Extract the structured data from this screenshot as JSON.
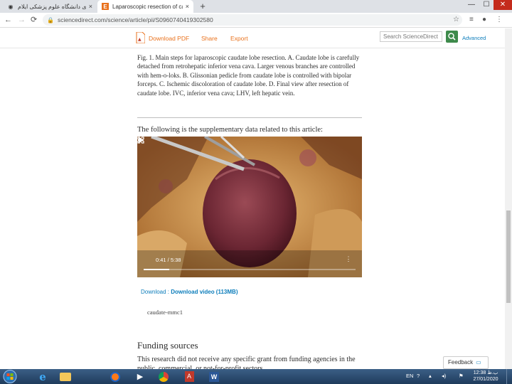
{
  "browser": {
    "tabs": [
      {
        "title": "کتابخانه مرکزی دانشگاه علوم پزشکی ایلام",
        "active": false
      },
      {
        "title": "Laparoscopic resection of caudate",
        "active": true
      }
    ],
    "new_tab": "+",
    "window_controls": {
      "minimize": "—",
      "maximize": "☐",
      "close": "✕"
    },
    "url": "sciencedirect.com/science/article/pii/S0960740419302580"
  },
  "header": {
    "download_pdf": "Download PDF",
    "share": "Share",
    "export": "Export",
    "search_placeholder": "Search ScienceDirect",
    "advanced": "Advanced"
  },
  "article": {
    "caption": "Fig. 1. Main steps for laparoscopic caudate lobe resection. A. Caudate lobe is carefully detached from retrohepatic inferior vena cava. Larger venous branches are controlled with hem-o-loks. B. Glissonian pedicle from caudate lobe is controlled with bipolar forceps. C. Ischemic discoloration of caudate lobe. D. Final view after resection of caudate lobe. IVC, inferior vena cava; LHV, left hepatic vein.",
    "supplementary_heading": "The following is the supplementary data related to this article:",
    "video": {
      "time": "0:41 / 5:38",
      "progress": 0.12
    },
    "download_prefix": "Download : ",
    "download_label": "Download video (113MB)",
    "video_filename": "caudate-mmc1",
    "funding_heading": "Funding sources",
    "funding_text": "This research did not receive any specific grant from funding agencies in the public, commercial, or not-for-profit sectors."
  },
  "feedback": {
    "label": "Feedback",
    "icon": "speech-bubble-icon"
  },
  "taskbar": {
    "apps": [
      "internet-explorer-icon",
      "file-explorer-icon",
      "firefox-icon",
      "media-player-icon",
      "generic-app-icon",
      "acrobat-icon",
      "chrome-icon",
      "word-icon"
    ],
    "lang": "EN",
    "time": "12:38 ب.ظ",
    "date": "27/01/2020"
  },
  "colors": {
    "accent": "#e9711c",
    "link": "#0c7dbb",
    "search_green": "#3e8a4b"
  }
}
